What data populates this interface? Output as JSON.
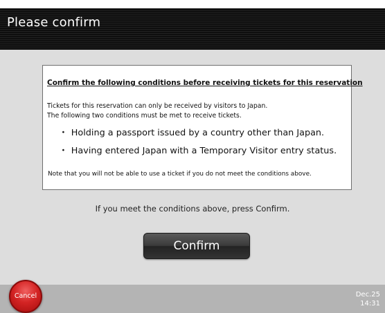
{
  "header": {
    "title": "Please confirm"
  },
  "notice": {
    "heading": "Confirm the following conditions before receiving tickets for this reservation",
    "intro_lines": [
      "Tickets for this reservation can only be received by visitors to Japan.",
      "The following two conditions must be met to receive tickets."
    ],
    "bullet_symbol": "・",
    "conditions": [
      "Holding a passport issued by a country other than Japan.",
      "Having entered Japan with a Temporary Visitor entry status."
    ],
    "footer_note": "Note that you will not be able to use a ticket if you do not meet the conditions above."
  },
  "prompt": "If you meet the conditions above, press Confirm.",
  "buttons": {
    "confirm_label": "Confirm",
    "cancel_label": "Cancel"
  },
  "status": {
    "date": "Dec.25",
    "time": "14:31"
  },
  "colors": {
    "header_bg": "#141414",
    "content_bg": "#dddddd",
    "footer_bg": "#b4b4b4",
    "cancel_red": "#d42424",
    "confirm_dark": "#333333"
  }
}
